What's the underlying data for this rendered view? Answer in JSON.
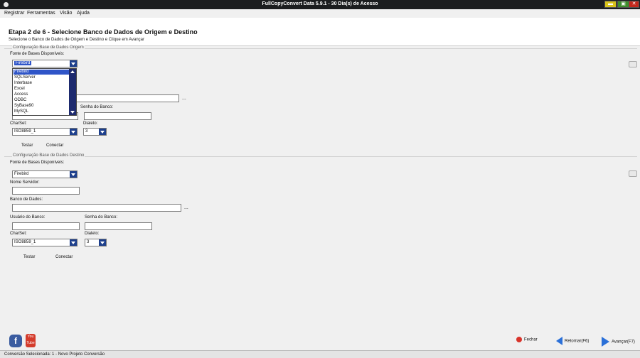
{
  "window": {
    "title": "FullCopyConvert Data 5.9.1 - 30 Dia(s) de Acesso",
    "min": "▬",
    "max": "▣",
    "close": "✕"
  },
  "menu": [
    "Registrar",
    "Ferramentas",
    "Visão",
    "Ajuda"
  ],
  "header": {
    "title": "Etapa 2 de 6 - Selecione Banco de Dados de Origem e Destino",
    "subtitle": "Selecione o Banco de Dados de Origem e Destino e Clique em Avançar"
  },
  "origem": {
    "legend": "Configuração Base de Dados Origem",
    "fonte_label": "Fonte de Bases Disponíveis:",
    "fonte_value": "Firebird",
    "senha_label": "Senha do Banco:",
    "charset_label": "CharSet:",
    "charset_value": "ISO8859_1",
    "dialeto_label": "Dialeto:",
    "dialeto_value": "3",
    "testar": "Testar",
    "conectar": "Conectar",
    "dots": "...",
    "dropdown_options": [
      "Firebird",
      "SQLServer",
      "Interbase",
      "Excel",
      "Access",
      "ODBC",
      "SyBase90",
      "MySQL"
    ]
  },
  "destino": {
    "legend": "Configuração Base de Dados Destino",
    "fonte_label": "Fonte de Bases Disponíveis:",
    "fonte_value": "Firebird",
    "servidor_label": "Nome Servidor:",
    "banco_label": "Banco de Dados:",
    "usuario_label": "Usuário do Banco:",
    "senha_label": "Senha do Banco:",
    "charset_label": "CharSet:",
    "charset_value": "ISO8859_1",
    "dialeto_label": "Dialeto:",
    "dialeto_value": "3",
    "testar": "Testar",
    "conectar": "Conectar",
    "dots": "..."
  },
  "bottom": {
    "fechar": "Fechar",
    "retornar": "Retornar(F6)",
    "avancar": "Avançar(F7)",
    "youtube": "You Tube",
    "facebook": "f"
  },
  "status": "Conversão Selecionada: 1 - Novo Projeto Conversão",
  "colors": {
    "accent": "#1d3f8c",
    "selection": "#2f55c8",
    "titlebar": "#1b1d1f"
  }
}
